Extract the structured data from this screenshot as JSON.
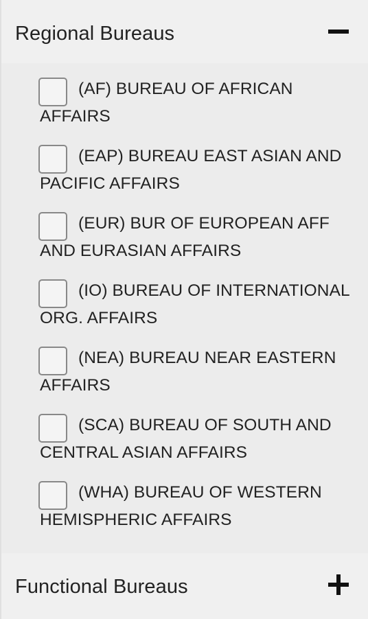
{
  "sections": {
    "regional": {
      "title": "Regional Bureaus",
      "expanded": true,
      "toggle_icon": "minus-icon",
      "items": [
        {
          "label": "(AF) BUREAU OF AFRICAN AFFAIRS",
          "checked": false
        },
        {
          "label": "(EAP) BUREAU EAST ASIAN AND PACIFIC AFFAIRS",
          "checked": false
        },
        {
          "label": "(EUR) BUR OF EUROPEAN AFF AND EURASIAN AFFAIRS",
          "checked": false
        },
        {
          "label": "(IO) BUREAU OF INTERNATIONAL ORG. AFFAIRS",
          "checked": false
        },
        {
          "label": "(NEA) BUREAU NEAR EASTERN AFFAIRS",
          "checked": false
        },
        {
          "label": "(SCA) BUREAU OF SOUTH AND CENTRAL ASIAN AFFAIRS",
          "checked": false
        },
        {
          "label": "(WHA) BUREAU OF WESTERN HEMISPHERIC AFFAIRS",
          "checked": false
        }
      ]
    },
    "functional": {
      "title": "Functional Bureaus",
      "expanded": false,
      "toggle_icon": "plus-icon"
    }
  }
}
